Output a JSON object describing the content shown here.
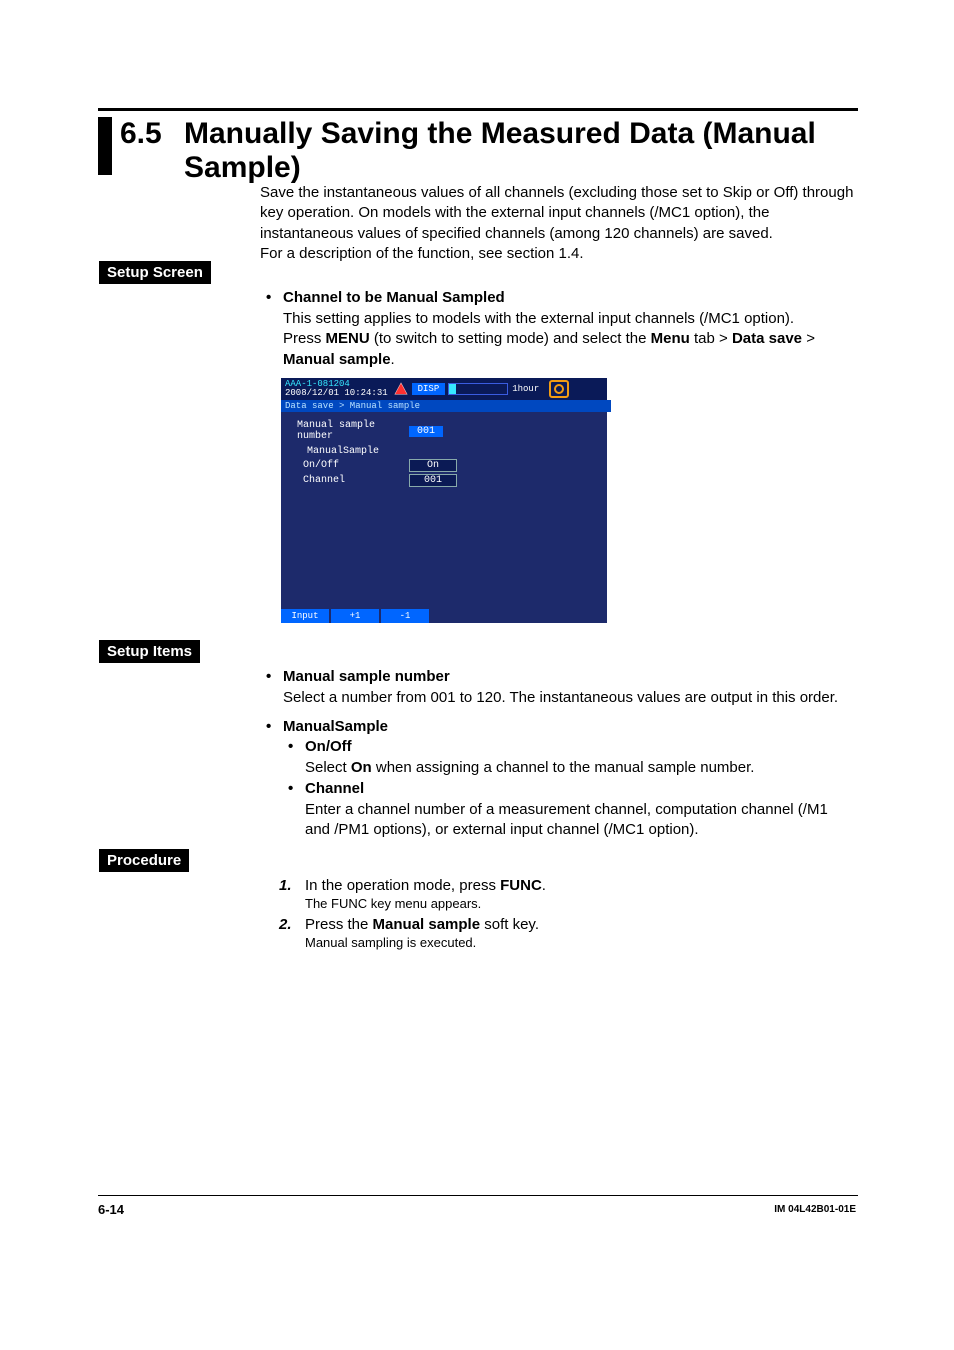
{
  "section": {
    "number": "6.5",
    "title": "Manually Saving the Measured Data (Manual Sample)"
  },
  "intro": "Save the instantaneous values of all channels (excluding those set to Skip or Off) through key operation. On models with the external input channels (/MC1 option), the instantaneous values of specified channels (among 120 channels) are saved.\nFor a description of the function, see section 1.4.",
  "labels": {
    "setup_screen": "Setup Screen",
    "setup_items": "Setup Items",
    "procedure": "Procedure"
  },
  "setup_screen": {
    "heading": "Channel to be Manual Sampled",
    "line1": "This setting applies to models with the external input channels (/MC1 option).",
    "line2_pre": "Press ",
    "line2_menu": "MENU",
    "line2_mid": " (to switch to setting mode) and select the ",
    "line2_menu_tab": "Menu",
    "line2_gt1": " tab > ",
    "line2_datasave": "Data save",
    "line2_gt2": " > ",
    "line2_manual": "Manual sample",
    "line2_end": "."
  },
  "device": {
    "id_line1": "AAA-1-081204",
    "id_line2": "2008/12/01 10:24:31",
    "disp": "DISP",
    "one_hour": "1hour",
    "breadcrumb": "Data save > Manual sample",
    "field_label": "Manual sample number",
    "field_value": "001",
    "group_title": "ManualSample",
    "onoff_label": "On/Off",
    "onoff_value": "On",
    "channel_label": "Channel",
    "channel_value": "001",
    "softkeys": [
      "Input",
      "+1",
      "-1"
    ]
  },
  "setup_items": {
    "msn_head": "Manual sample number",
    "msn_body": "Select a number from 001 to 120. The instantaneous values are output in this order.",
    "ms_head": "ManualSample",
    "onoff_head": "On/Off",
    "onoff_body_pre": "Select ",
    "onoff_body_on": "On",
    "onoff_body_post": " when assigning a channel to the manual sample number.",
    "channel_head": "Channel",
    "channel_body": "Enter a channel number of a measurement channel, computation channel (/M1 and /PM1 options), or external input channel (/MC1 option)."
  },
  "procedure": {
    "s1_num": "1.",
    "s1_main_pre": "In the operation mode, press ",
    "s1_main_func": "FUNC",
    "s1_main_post": ".",
    "s1_sub": "The FUNC key menu appears.",
    "s2_num": "2.",
    "s2_main_pre": "Press the ",
    "s2_main_ms": "Manual sample",
    "s2_main_post": " soft key.",
    "s2_sub": "Manual sampling is executed."
  },
  "footer": {
    "left": "6-14",
    "right": "IM 04L42B01-01E"
  }
}
